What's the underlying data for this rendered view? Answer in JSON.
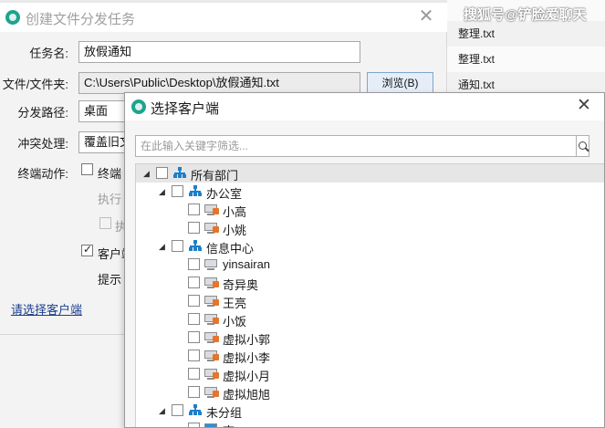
{
  "background_window": {
    "rows": [
      "整理.txt",
      "整理.txt",
      "通知.txt"
    ],
    "watermark": "搜狐号@铲脸爱聊天"
  },
  "task_dialog": {
    "title": "创建文件分发任务",
    "close_glyph": "✕",
    "task_name": {
      "label": "任务名:",
      "value": "放假通知"
    },
    "file": {
      "label": "文件/文件夹:",
      "value": "C:\\Users\\Public\\Desktop\\放假通知.txt",
      "browse_label": "浏览(B)"
    },
    "dist_path": {
      "label": "分发路径:",
      "value": "桌面"
    },
    "conflict": {
      "label": "冲突处理:",
      "value": "覆盖旧文"
    },
    "terminal_action": {
      "label": "终端动作:",
      "checkbox_label": "终端"
    },
    "exec_text": "执行",
    "exec_checkbox_label": "执",
    "client_checkbox_label": "客户端",
    "hint_text": "提示",
    "select_clients_link": "请选择客户端"
  },
  "client_dialog": {
    "title": "选择客户端",
    "close_glyph": "✕",
    "search": {
      "placeholder": "在此输入关键字筛选..."
    },
    "tree": {
      "root": "所有部门",
      "groups": [
        {
          "name": "办公室",
          "clients": [
            "小高",
            "小姚"
          ]
        },
        {
          "name": "信息中心",
          "clients": [
            "yinsairan",
            "奇异奥",
            "王亮",
            "小饭",
            "虚拟小郭",
            "虚拟小李",
            "虚拟小月",
            "虚拟旭旭"
          ]
        },
        {
          "name": "未分组",
          "clients": [
            "李"
          ]
        }
      ]
    }
  },
  "colors": {
    "accent_teal": "#1fa38c",
    "org_blue": "#1e7fc9",
    "lock_orange": "#e8742a",
    "link_blue": "#1c3f8f"
  },
  "icons": [
    "app-logo-icon",
    "close-icon",
    "search-icon",
    "org-tree-icon",
    "client-pc-icon",
    "collapse-arrow-icon"
  ]
}
